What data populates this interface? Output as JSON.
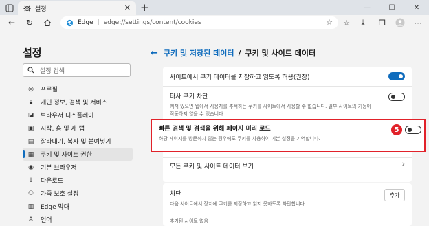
{
  "tab": {
    "title": "설정"
  },
  "address": {
    "brand": "Edge",
    "url": "edge://settings/content/cookies"
  },
  "sidebar": {
    "title": "설정",
    "search_placeholder": "설정 검색",
    "items": [
      {
        "label": "프로필",
        "icon": "profile-icon"
      },
      {
        "label": "개인 정보, 검색 및 서비스",
        "icon": "lock-icon"
      },
      {
        "label": "브라우저 디스플레이",
        "icon": "display-icon"
      },
      {
        "label": "시작, 홈 및 새 탭",
        "icon": "home-icon"
      },
      {
        "label": "잘라내기, 복사 및 붙여넣기",
        "icon": "clipboard-icon"
      },
      {
        "label": "쿠키 및 사이트 권한",
        "icon": "cookie-icon",
        "active": true
      },
      {
        "label": "기본 브라우저",
        "icon": "browser-icon"
      },
      {
        "label": "다운로드",
        "icon": "download-icon"
      },
      {
        "label": "가족 보호 설정",
        "icon": "family-icon"
      },
      {
        "label": "Edge 막대",
        "icon": "edge-bar-icon"
      },
      {
        "label": "언어",
        "icon": "language-icon"
      }
    ]
  },
  "main": {
    "breadcrumb_link": "쿠키 및 저장된 데이터",
    "breadcrumb_current": "쿠키 및 사이트 데이터",
    "settings": [
      {
        "label": "사이트에서 쿠키 데이터를 저장하고 읽도록 허용(권장)",
        "toggle": "on"
      },
      {
        "label": "타사 쿠키 차단",
        "desc": "켜져 있으면 웹에서 사용자를 추적하는 쿠키를 사이트에서 사용할 수 없습니다. 일부 사이트의 기능이 작동하지 않을 수 있습니다.",
        "toggle": "off"
      },
      {
        "label": "빠른 검색 및 검색을 위해 페이지 미리 로드",
        "desc": "하당 페이지를 방문하지 않는 경우에도 쿠키를 사용하여 기본 설정을 기억합니다.",
        "toggle": "off",
        "badge": "5"
      },
      {
        "label": "모든 쿠키 및 사이트 데이터 보기"
      }
    ],
    "block": {
      "title": "차단",
      "desc": "다음 사이트에서 장치에 쿠키를 저장하고 읽지 못하도록 차단합니다.",
      "add_label": "추가",
      "empty_label": "추가된 사이트 없음"
    }
  },
  "colors": {
    "accent": "#0f6cbd",
    "highlight": "#e1222a"
  }
}
